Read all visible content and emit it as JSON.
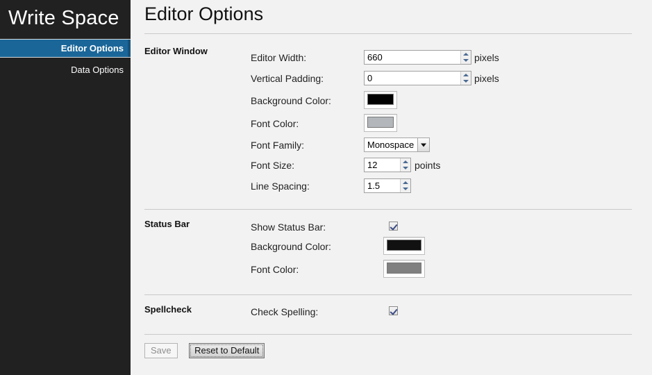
{
  "sidebar": {
    "brand": "Write Space",
    "items": [
      {
        "label": "Editor Options",
        "active": true
      },
      {
        "label": "Data Options",
        "active": false
      }
    ]
  },
  "page": {
    "title": "Editor Options"
  },
  "sections": {
    "editor_window": {
      "title": "Editor Window",
      "fields": {
        "editor_width": {
          "label": "Editor Width:",
          "value": "660",
          "unit": "pixels"
        },
        "vertical_padding": {
          "label": "Vertical Padding:",
          "value": "0",
          "unit": "pixels"
        },
        "background_color": {
          "label": "Background Color:",
          "color": "#000000"
        },
        "font_color": {
          "label": "Font Color:",
          "color": "#b3b7bb"
        },
        "font_family": {
          "label": "Font Family:",
          "value": "Monospace"
        },
        "font_size": {
          "label": "Font Size:",
          "value": "12",
          "unit": "points"
        },
        "line_spacing": {
          "label": "Line Spacing:",
          "value": "1.5"
        }
      }
    },
    "status_bar": {
      "title": "Status Bar",
      "fields": {
        "show_status_bar": {
          "label": "Show Status Bar:",
          "checked": true
        },
        "background_color": {
          "label": "Background Color:",
          "color": "#111111"
        },
        "font_color": {
          "label": "Font Color:",
          "color": "#808080"
        }
      }
    },
    "spellcheck": {
      "title": "Spellcheck",
      "fields": {
        "check_spelling": {
          "label": "Check Spelling:",
          "checked": true
        }
      }
    }
  },
  "actions": {
    "save_label": "Save",
    "reset_label": "Reset to Default"
  },
  "colors": {
    "sidebar_bg": "#212121",
    "accent": "#1a6699",
    "page_bg": "#f2f2f2"
  }
}
